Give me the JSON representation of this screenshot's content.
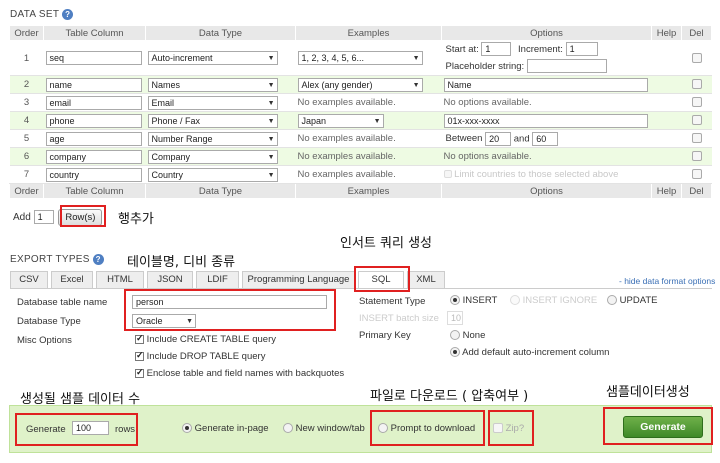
{
  "dataset": {
    "title": "DATA SET",
    "columns": [
      "Order",
      "Table Column",
      "Data Type",
      "Examples",
      "Options",
      "Help",
      "Del"
    ],
    "rows": [
      {
        "order": "1",
        "column": "seq",
        "type": "Auto-increment",
        "example": "1, 2, 3, 4, 5, 6...",
        "example_select": true,
        "opt_start_label": "Start at:",
        "opt_start": "1",
        "opt_inc_label": "Increment:",
        "opt_inc": "1",
        "opt_ph_label": "Placeholder string:"
      },
      {
        "order": "2",
        "column": "name",
        "type": "Names",
        "example": "Alex (any gender)",
        "example_select": true,
        "option_input": "Name"
      },
      {
        "order": "3",
        "column": "email",
        "type": "Email",
        "example": "No examples available.",
        "option_text": "No options available."
      },
      {
        "order": "4",
        "column": "phone",
        "type": "Phone / Fax",
        "example": "Japan",
        "example_select": true,
        "option_input": "01x-xxx-xxxx"
      },
      {
        "order": "5",
        "column": "age",
        "type": "Number Range",
        "example": "No examples available.",
        "opt_between": "Between",
        "opt_from": "20",
        "opt_and": "and",
        "opt_to": "60"
      },
      {
        "order": "6",
        "column": "company",
        "type": "Company",
        "example": "No examples available.",
        "option_text": "No options available."
      },
      {
        "order": "7",
        "column": "country",
        "type": "Country",
        "example": "No examples available.",
        "option_check": "Limit countries to those selected above"
      }
    ],
    "add_label": "Add",
    "add_value": "1",
    "rows_button": "Row(s)"
  },
  "export": {
    "title": "EXPORT TYPES",
    "tabs": [
      "CSV",
      "Excel",
      "HTML",
      "JSON",
      "LDIF",
      "Programming Language",
      "SQL",
      "XML"
    ],
    "active_tab": "SQL",
    "hide_link": "- hide data format options",
    "db_table_label": "Database table name",
    "db_table_value": "person",
    "db_type_label": "Database Type",
    "db_type_value": "Oracle",
    "misc_label": "Misc Options",
    "misc": [
      "Include CREATE TABLE query",
      "Include DROP TABLE query",
      "Enclose table and field names with backquotes"
    ],
    "stmt_label": "Statement Type",
    "stmt_options": [
      "INSERT",
      "INSERT IGNORE",
      "UPDATE"
    ],
    "batch_label": "INSERT batch size",
    "batch_value": "10",
    "pk_label": "Primary Key",
    "pk_options": [
      "None",
      "Add default auto-increment column"
    ]
  },
  "generate": {
    "label": "Generate",
    "value": "100",
    "unit": "rows",
    "modes": [
      "Generate in-page",
      "New window/tab",
      "Prompt to download"
    ],
    "zip": "Zip?",
    "button": "Generate"
  },
  "annotations": {
    "add_row": "행추가",
    "table_db": "테이블명, 디비 종류",
    "insert_query": "인서트 쿼리 생성",
    "sample_count": "생성될 샘플 데이터 수",
    "download": "파일로 다운로드 ( 압축여부 )",
    "generate": "샘플데이터생성"
  }
}
